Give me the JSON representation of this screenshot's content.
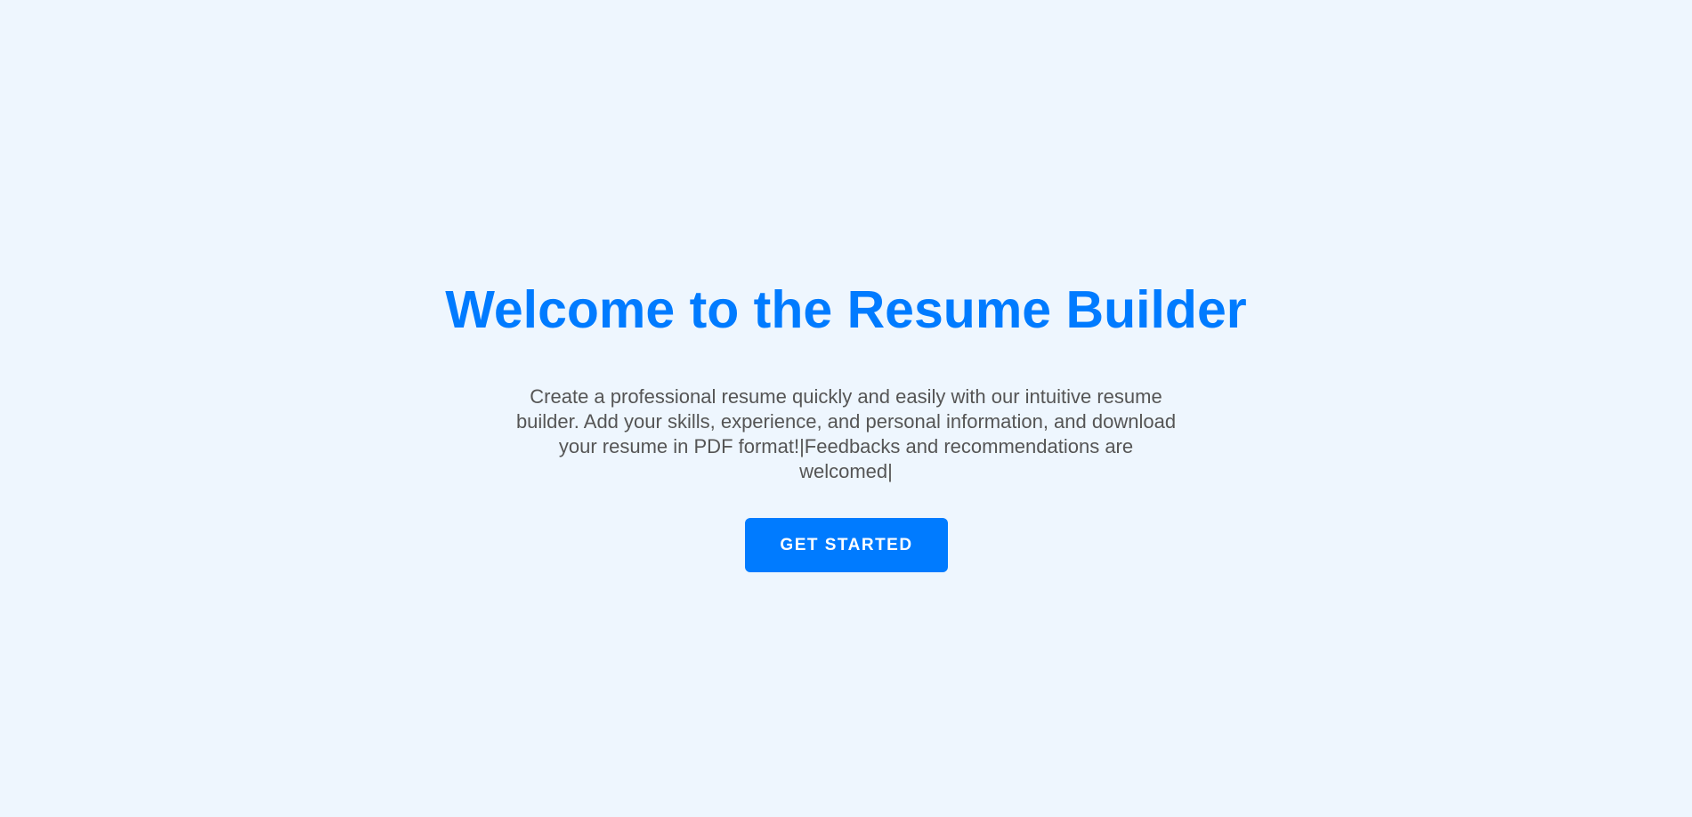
{
  "hero": {
    "title": "Welcome to the Resume Builder",
    "description": "Create a professional resume quickly and easily with our intuitive resume builder. Add your skills, experience, and personal information, and download your resume in PDF format!|Feedbacks and recommendations are welcomed|",
    "cta_label": "GET STARTED"
  },
  "colors": {
    "accent": "#007bff",
    "background": "#eef6fe",
    "text": "#555555"
  }
}
